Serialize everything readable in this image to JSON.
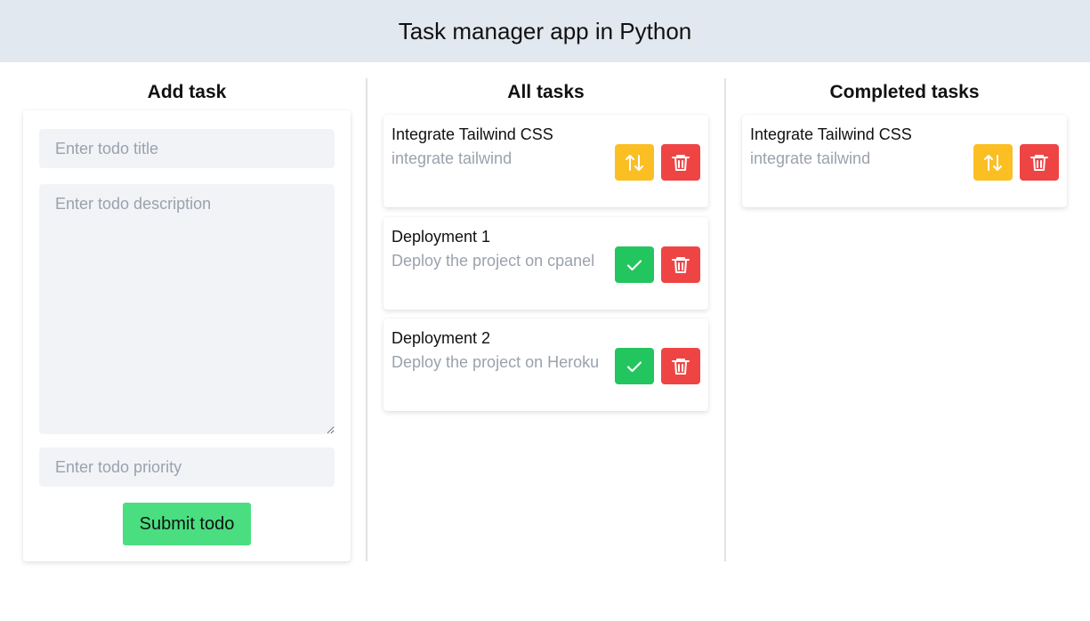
{
  "header": {
    "title": "Task manager app in Python"
  },
  "columns": {
    "add": "Add task",
    "all": "All tasks",
    "completed": "Completed tasks"
  },
  "form": {
    "title_placeholder": "Enter todo title",
    "description_placeholder": "Enter todo description",
    "priority_placeholder": "Enter todo priority",
    "submit_label": "Submit todo"
  },
  "all_tasks": [
    {
      "title": "Integrate Tailwind CSS",
      "description": "integrate tailwind",
      "action_icon": "arrows-up-down-icon"
    },
    {
      "title": "Deployment 1",
      "description": "Deploy the project on cpanel",
      "action_icon": "check-icon"
    },
    {
      "title": "Deployment 2",
      "description": "Deploy the project on Heroku",
      "action_icon": "check-icon"
    }
  ],
  "completed_tasks": [
    {
      "title": "Integrate Tailwind CSS",
      "description": "integrate tailwind",
      "action_icon": "arrows-up-down-icon"
    }
  ],
  "colors": {
    "header_bg": "#e2e8f0",
    "toggle": "#fbbf24",
    "complete": "#22c55e",
    "delete": "#ef4444",
    "submit": "#4ade80"
  }
}
